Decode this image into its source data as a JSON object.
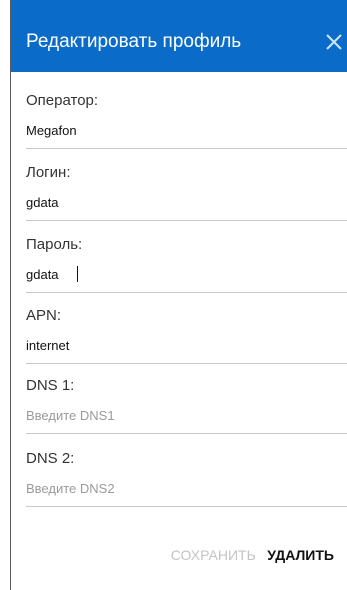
{
  "dialog": {
    "title": "Редактировать профиль",
    "close_icon": "close-icon",
    "header_color": "#0a6bc8"
  },
  "fields": {
    "operator": {
      "label": "Оператор:",
      "value": "Megafon",
      "placeholder": ""
    },
    "login": {
      "label": "Логин:",
      "value": "gdata",
      "placeholder": ""
    },
    "password": {
      "label": "Пароль:",
      "value": "gdata",
      "placeholder": ""
    },
    "apn": {
      "label": "APN:",
      "value": "internet",
      "placeholder": ""
    },
    "dns1": {
      "label": "DNS 1:",
      "value": "",
      "placeholder": "Введите DNS1"
    },
    "dns2": {
      "label": "DNS 2:",
      "value": "",
      "placeholder": "Введите DNS2"
    }
  },
  "actions": {
    "save_label": "СОХРАНИТЬ",
    "delete_label": "УДАЛИТЬ"
  }
}
